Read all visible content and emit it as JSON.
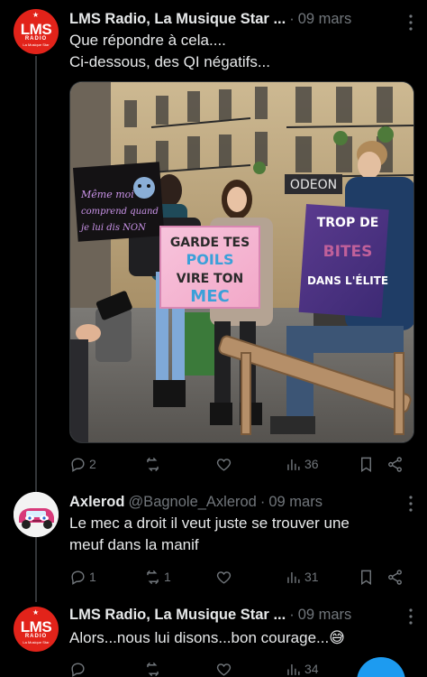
{
  "tweets": [
    {
      "name": "LMS Radio, La Musique Star ...",
      "date": "09 mars",
      "text_lines": [
        "Que répondre à  cela....",
        "Ci-dessous,  des QI négatifs..."
      ],
      "avatar": {
        "top": "LMS",
        "mid": "RADIO",
        "bottom": "La Musique Star"
      },
      "image": {
        "sign1": [
          "Même moi",
          "je",
          "comprend quand",
          "je lui dis NON"
        ],
        "sign2": [
          "GARDE TES",
          "POILS",
          "VIRE TON",
          "MEC"
        ],
        "sign3": [
          "TROP DE",
          "BITES",
          "DANS L'ÉLITE"
        ],
        "building_sign": "ODEON"
      },
      "actions": {
        "replies": "2",
        "retweets": "",
        "likes": "",
        "views": "36"
      }
    },
    {
      "name": "Axlerod",
      "handle": "@Bagnole_Axlerod",
      "date": "09 mars",
      "text_lines": [
        "Le mec a droit il veut juste se trouver une",
        "meuf dans la manif"
      ],
      "actions": {
        "replies": "1",
        "retweets": "1",
        "likes": "",
        "views": "31"
      }
    },
    {
      "name": "LMS Radio, La Musique Star ...",
      "date": "09 mars",
      "text_lines": [
        "Alors...nous lui disons...bon courage...😅"
      ],
      "avatar": {
        "top": "LMS",
        "mid": "RADIO",
        "bottom": "La Musique Star"
      },
      "actions": {
        "replies": "",
        "retweets": "",
        "likes": "",
        "views": "34"
      }
    }
  ],
  "colors": {
    "background": "#000000",
    "text": "#e7e9ea",
    "muted": "#71767b",
    "brand_red": "#e2231a",
    "accent": "#1d9bf0"
  }
}
